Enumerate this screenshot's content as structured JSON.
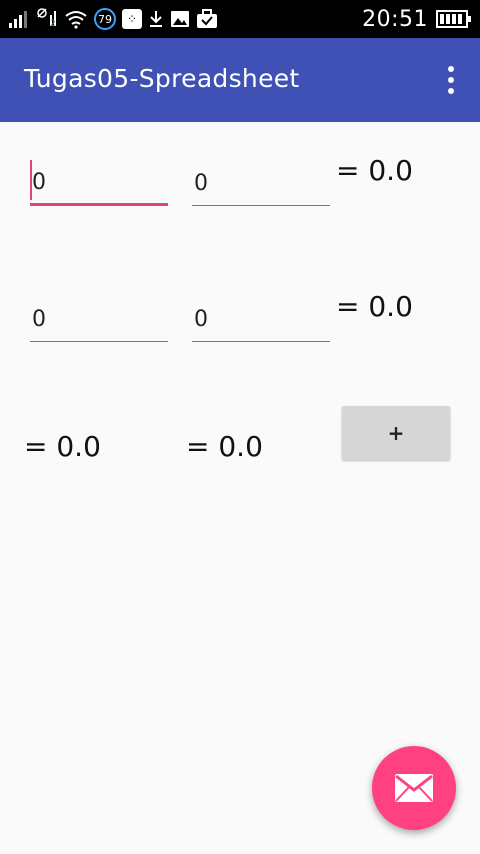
{
  "status_bar": {
    "time": "20:51",
    "notification_count": "79",
    "sim_label": "2",
    "icons": [
      "signal-icon",
      "no-signal-icon",
      "wifi-icon",
      "bbm-icon",
      "download-icon",
      "image-icon",
      "briefcase-check-icon",
      "battery-icon"
    ]
  },
  "app_bar": {
    "title": "Tugas05-Spreadsheet",
    "background": "#3f51b5"
  },
  "row1": {
    "input_a": "0",
    "input_b": "0",
    "result": "= 0.0"
  },
  "row2": {
    "input_a": "0",
    "input_b": "0",
    "result": "= 0.0"
  },
  "row3": {
    "result_a": "= 0.0",
    "result_b": "= 0.0",
    "button_label": "+"
  },
  "fab": {
    "icon": "email-icon",
    "color": "#ff4081"
  },
  "colors": {
    "accent": "#e2447a",
    "button_bg": "#d6d6d6"
  }
}
